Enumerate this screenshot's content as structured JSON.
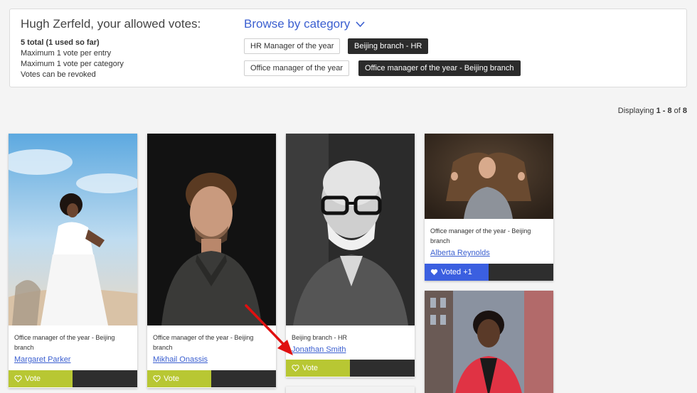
{
  "header": {
    "welcome": "Hugh Zerfeld, your allowed votes:",
    "rules": [
      "5 total (1 used so far)",
      "Maximum 1 vote per entry",
      "Maximum 1 vote per category",
      "Votes can be revoked"
    ],
    "browse_label": "Browse by category",
    "tags": [
      {
        "label": "HR Manager of the year",
        "selected": false
      },
      {
        "label": "Beijing branch - HR",
        "selected": true
      },
      {
        "label": "Office manager of the year",
        "selected": false
      },
      {
        "label": "Office manager of the year - Beijing branch",
        "selected": true
      }
    ]
  },
  "pagination": {
    "prefix": "Displaying ",
    "range": "1 - 8",
    "of": " of ",
    "total": "8"
  },
  "entries": [
    {
      "category": "Office manager of the year - Beijing branch",
      "name": "Margaret Parker",
      "vote_label": "Vote"
    },
    {
      "category": "Office manager of the year - Beijing branch",
      "name": "Mikhail Onassis",
      "vote_label": "Vote"
    },
    {
      "category": "Beijing branch - HR",
      "name": "Jonathan Smith",
      "vote_label": "Vote"
    },
    {
      "category": "Office manager of the year - Beijing branch",
      "name": "Alberta Reynolds",
      "vote_label": "Voted +1"
    },
    {
      "category": "",
      "name": "",
      "vote_label": ""
    },
    {
      "category": "",
      "name": "",
      "vote_label": ""
    }
  ],
  "colors": {
    "accent": "#3b5fd0",
    "vote_green": "#b8c733",
    "voted_blue": "#3b5fe0",
    "dark": "#2e2e2e",
    "annotation_red": "#e01010"
  },
  "icons": [
    "chevron-down-icon",
    "heart-outline-icon",
    "heart-filled-icon",
    "red-arrow-annotation"
  ]
}
